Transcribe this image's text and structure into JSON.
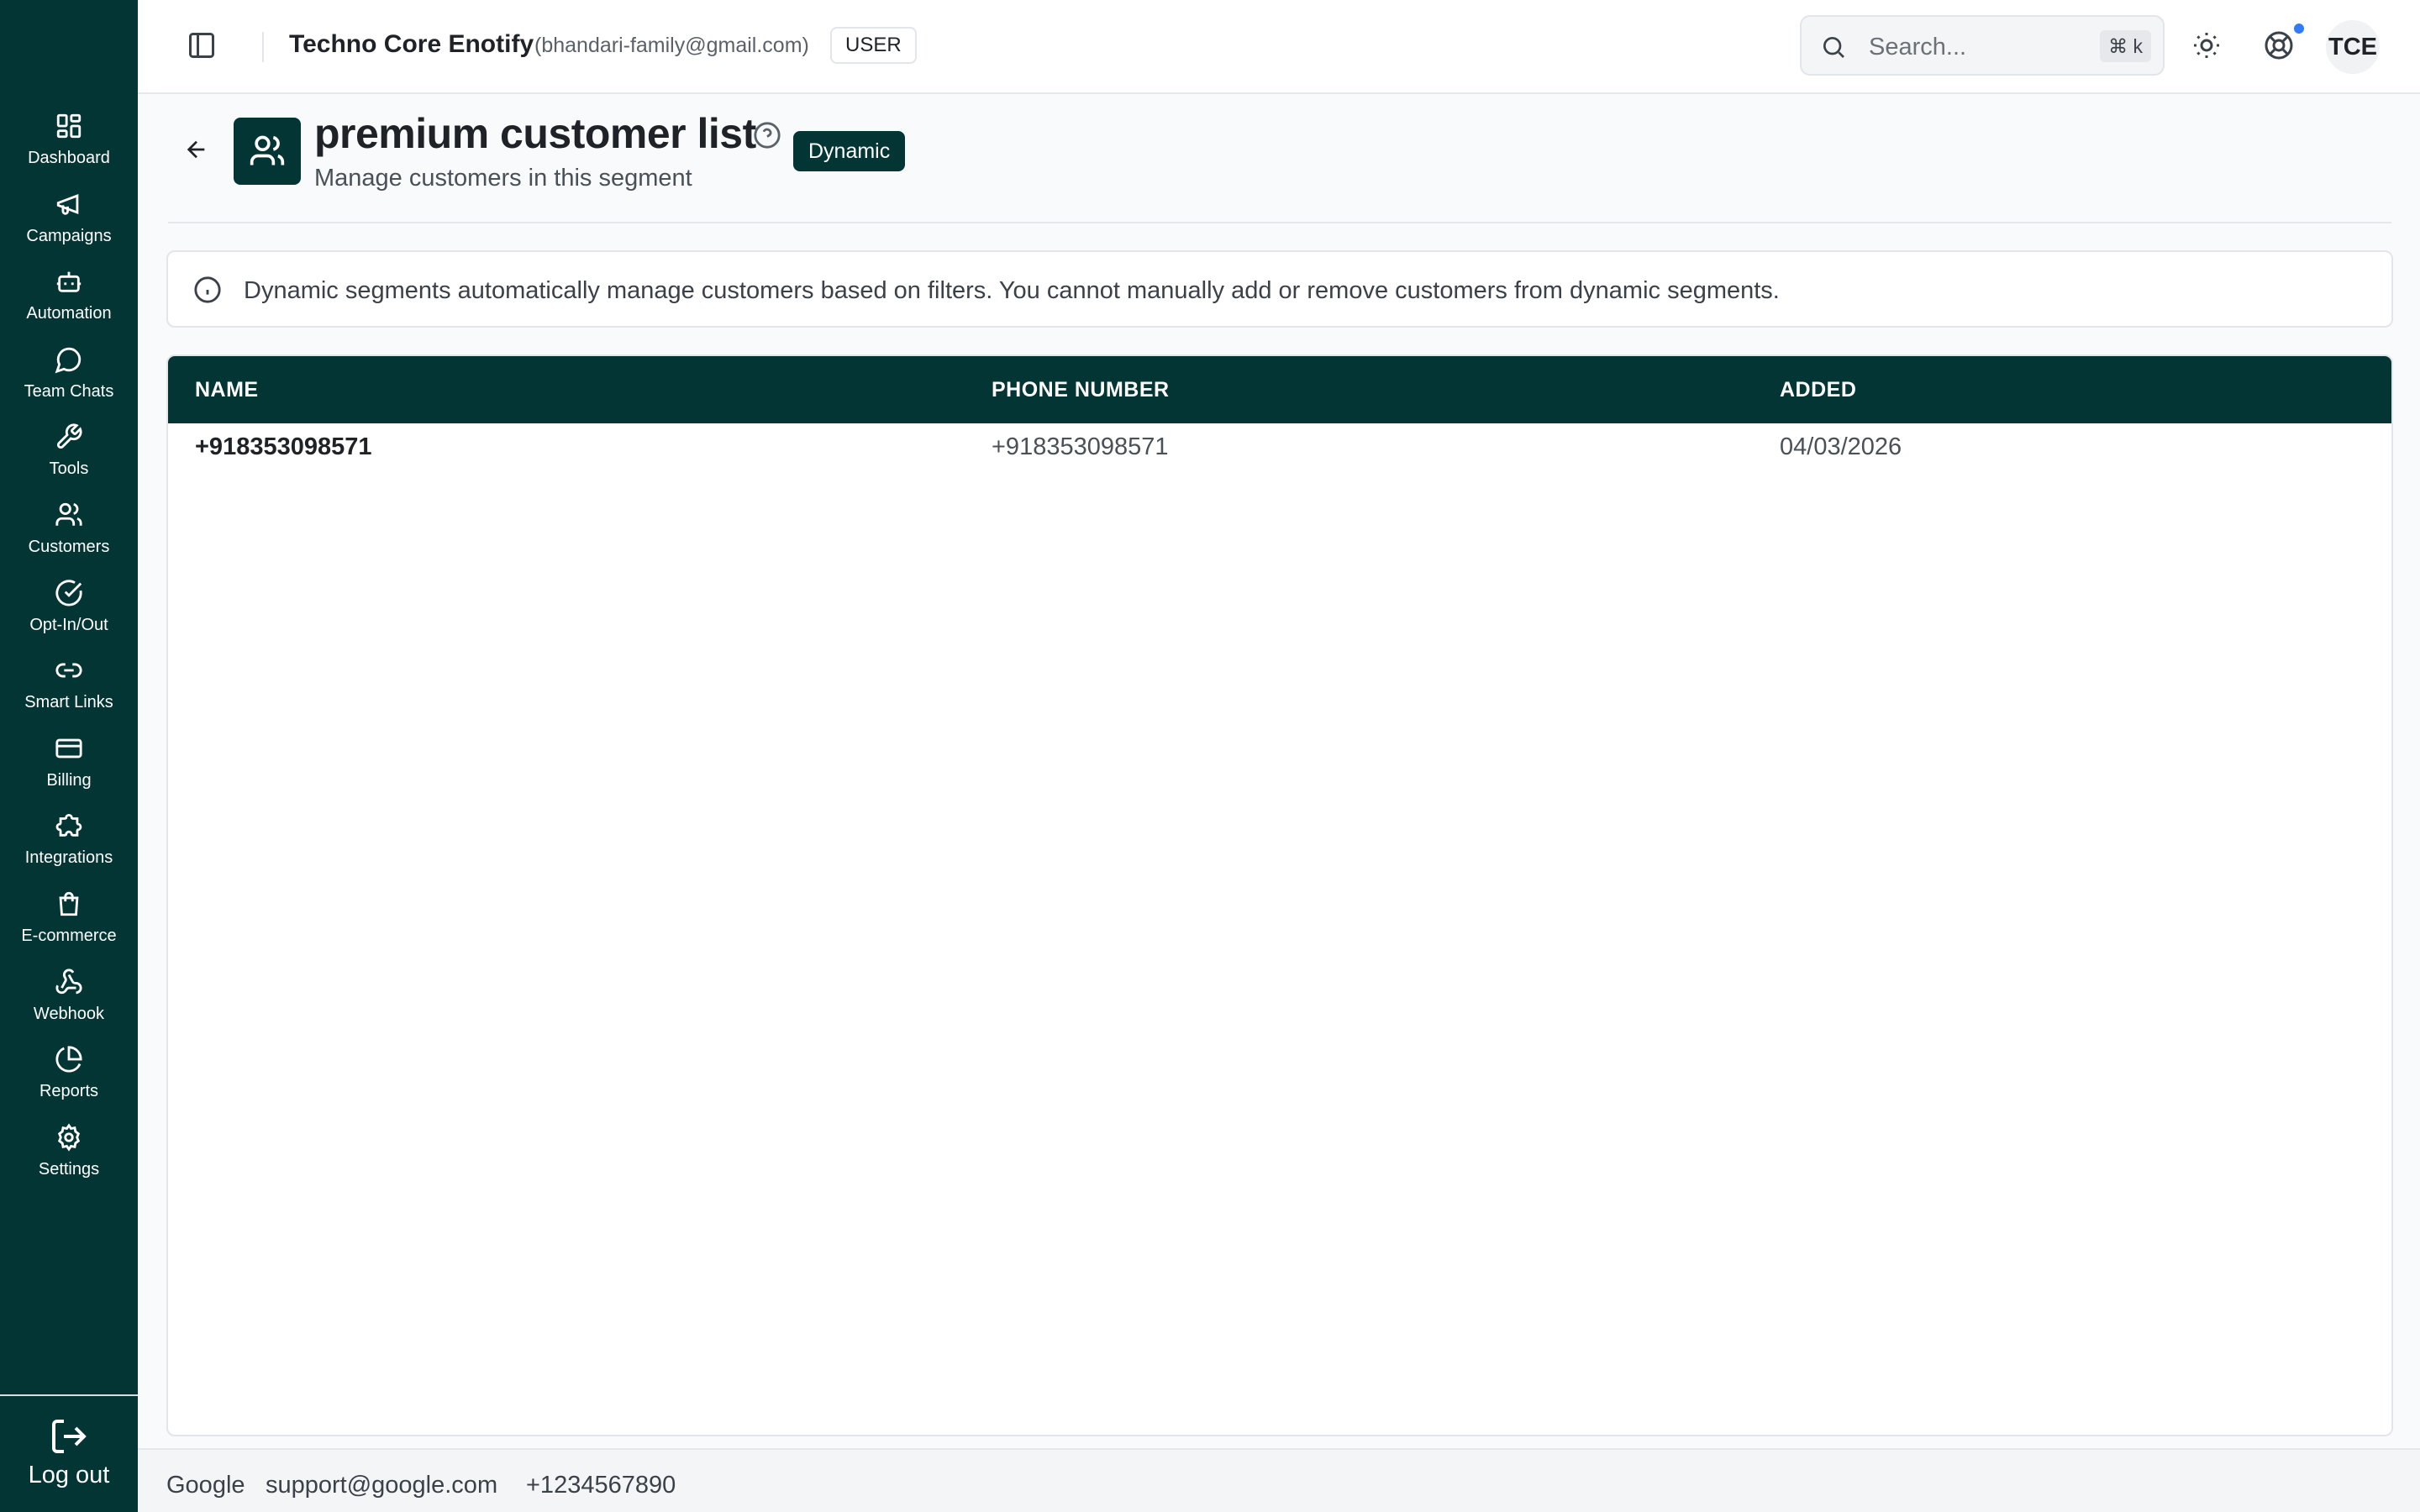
{
  "sidebar": {
    "items": [
      {
        "label": "Dashboard",
        "icon": "dashboard-icon"
      },
      {
        "label": "Campaigns",
        "icon": "megaphone-icon"
      },
      {
        "label": "Automation",
        "icon": "bot-icon"
      },
      {
        "label": "Team Chats",
        "icon": "chat-bubble-icon"
      },
      {
        "label": "Tools",
        "icon": "wrench-icon"
      },
      {
        "label": "Customers",
        "icon": "users-icon"
      },
      {
        "label": "Opt-In/Out",
        "icon": "check-circle-icon"
      },
      {
        "label": "Smart Links",
        "icon": "link-icon"
      },
      {
        "label": "Billing",
        "icon": "credit-card-icon"
      },
      {
        "label": "Integrations",
        "icon": "puzzle-icon"
      },
      {
        "label": "E-commerce",
        "icon": "shopping-bag-icon"
      },
      {
        "label": "Webhook",
        "icon": "webhook-icon"
      },
      {
        "label": "Reports",
        "icon": "pie-chart-icon"
      },
      {
        "label": "Settings",
        "icon": "gear-icon"
      }
    ],
    "logout_label": "Log out"
  },
  "header": {
    "org_name": "Techno Core Enotify",
    "email": "(bhandari-family@gmail.com)",
    "role": "USER",
    "search_placeholder": "Search...",
    "shortcut": "⌘ k",
    "avatar_initials": "TCE"
  },
  "page": {
    "title": "premium customer list",
    "subtitle": "Manage customers in this segment",
    "badge": "Dynamic"
  },
  "info": {
    "text": "Dynamic segments automatically manage customers based on filters. You cannot manually add or remove customers from dynamic segments."
  },
  "table": {
    "columns": [
      "NAME",
      "PHONE NUMBER",
      "ADDED"
    ],
    "rows": [
      {
        "name": "+918353098571",
        "phone": "+918353098571",
        "added": "04/03/2026"
      }
    ]
  },
  "footer": {
    "company": "Google",
    "email": "support@google.com",
    "phone": "+1234567890"
  },
  "colors": {
    "brand": "#043535",
    "notification": "#2f7cf6"
  }
}
